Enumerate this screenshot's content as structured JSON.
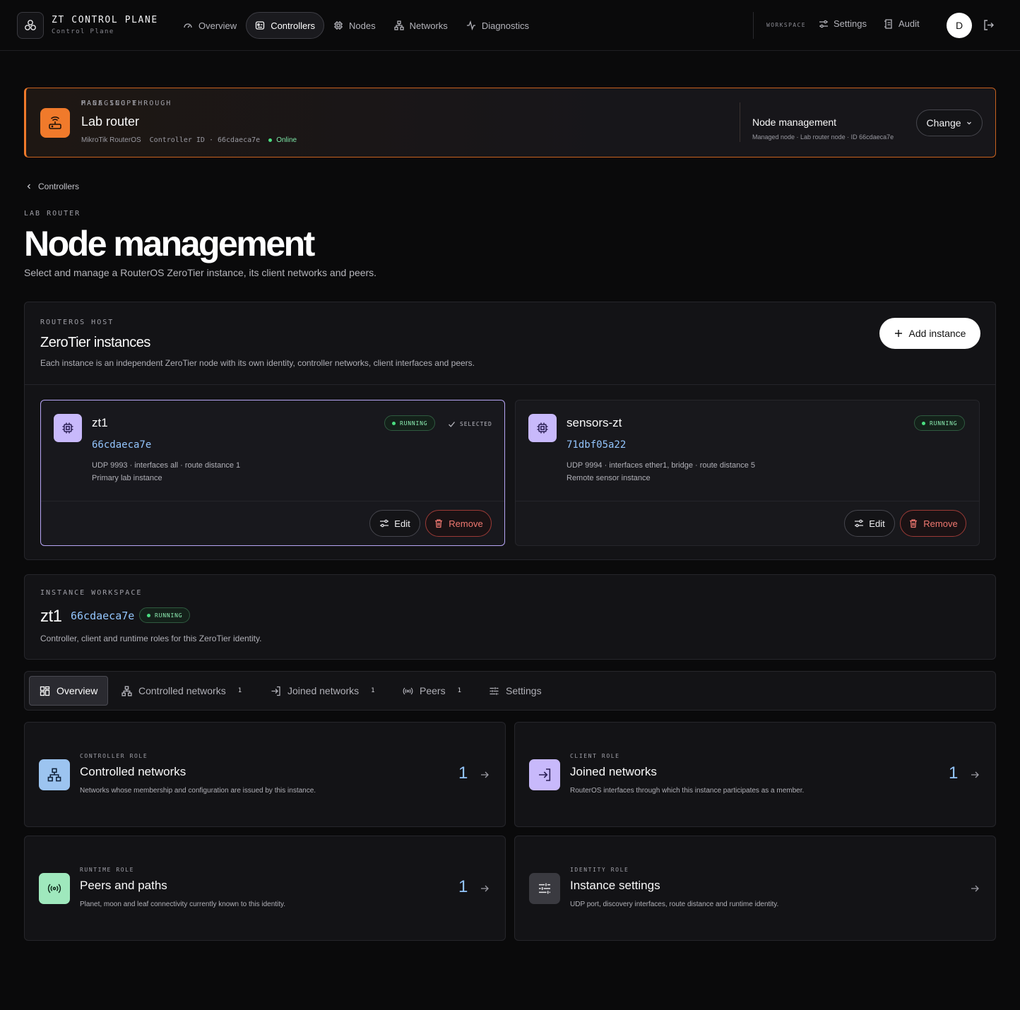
{
  "brand": {
    "title": "ZT CONTROL PLANE",
    "subtitle": "Control Plane"
  },
  "nav": {
    "items": [
      {
        "label": "Overview",
        "icon": "gauge-icon"
      },
      {
        "label": "Controllers",
        "icon": "controller-icon"
      },
      {
        "label": "Nodes",
        "icon": "chip-icon"
      },
      {
        "label": "Networks",
        "icon": "network-icon"
      },
      {
        "label": "Diagnostics",
        "icon": "pulse-icon"
      }
    ],
    "active": "Controllers",
    "workspace_label": "WORKSPACE",
    "settings_label": "Settings",
    "audit_label": "Audit",
    "avatar_initial": "D"
  },
  "banner": {
    "eyebrow": "MANAGING THROUGH",
    "title": "Lab router",
    "platform": "MikroTik RouterOS",
    "controller_id_text": "Controller ID · 66cdaeca7e",
    "status": "Online",
    "scope_eyebrow": "PAGE SCOPE",
    "scope_title": "Node management",
    "scope_meta": "Managed node · Lab router node · ID 66cdaeca7e",
    "change_label": "Change",
    "accent": "#f07a2b"
  },
  "header": {
    "breadcrumb": "Controllers",
    "eyebrow": "LAB ROUTER",
    "title": "Node management",
    "description": "Select and manage a RouterOS ZeroTier instance, its client networks and peers."
  },
  "instances": {
    "eyebrow": "ROUTEROS HOST",
    "title": "ZeroTier instances",
    "description": "Each instance is an independent ZeroTier node with its own identity, controller networks, client interfaces and peers.",
    "add_label": "Add instance",
    "items": [
      {
        "name": "zt1",
        "id": "66cdaeca7e",
        "status": "RUNNING",
        "selected_label": "SELECTED",
        "meta": "UDP 9993 · interfaces all · route distance 1",
        "note": "Primary lab instance",
        "edit_label": "Edit",
        "remove_label": "Remove"
      },
      {
        "name": "sensors-zt",
        "id": "71dbf05a22",
        "status": "RUNNING",
        "meta": "UDP 9994 · interfaces ether1, bridge · route distance 5",
        "note": "Remote sensor instance",
        "edit_label": "Edit",
        "remove_label": "Remove"
      }
    ]
  },
  "workspace": {
    "eyebrow": "INSTANCE WORKSPACE",
    "name": "zt1",
    "id": "66cdaeca7e",
    "status": "RUNNING",
    "description": "Controller, client and runtime roles for this ZeroTier identity."
  },
  "tabs": [
    {
      "label": "Overview",
      "count": ""
    },
    {
      "label": "Controlled networks",
      "count": "1"
    },
    {
      "label": "Joined networks",
      "count": "1"
    },
    {
      "label": "Peers",
      "count": "1"
    },
    {
      "label": "Settings",
      "count": ""
    }
  ],
  "roles": [
    {
      "eyebrow": "CONTROLLER ROLE",
      "title": "Controlled networks",
      "description": "Networks whose membership and configuration are issued by this instance.",
      "count": "1",
      "icon": "network-icon",
      "color": "#9cc4f0"
    },
    {
      "eyebrow": "CLIENT ROLE",
      "title": "Joined networks",
      "description": "RouterOS interfaces through which this instance participates as a member.",
      "count": "1",
      "icon": "join-icon",
      "color": "#c8b9fb"
    },
    {
      "eyebrow": "RUNTIME ROLE",
      "title": "Peers and paths",
      "description": "Planet, moon and leaf connectivity currently known to this identity.",
      "count": "1",
      "icon": "broadcast-icon",
      "color": "#9fe8bd"
    },
    {
      "eyebrow": "IDENTITY ROLE",
      "title": "Instance settings",
      "description": "UDP port, discovery interfaces, route distance and runtime identity.",
      "count": "",
      "icon": "sliders-icon",
      "color": "#3a3a40"
    }
  ]
}
